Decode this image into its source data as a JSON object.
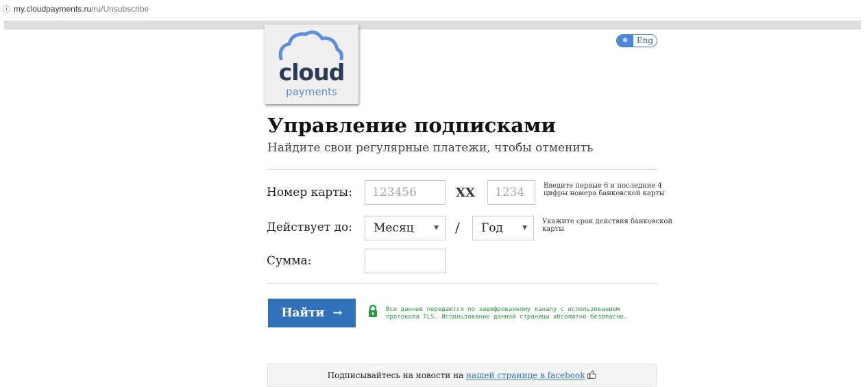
{
  "browser": {
    "url_host": "my.cloudpayments.ru",
    "url_path": "/ru/Unsubscribe"
  },
  "logo": {
    "line1": "cloud",
    "line2": "payments"
  },
  "lang_toggle": {
    "label": "Eng"
  },
  "page": {
    "title": "Управление подписками",
    "subtitle": "Найдите свои регулярные платежи, чтобы отменить"
  },
  "form": {
    "card_label": "Номер карты:",
    "card_first_placeholder": "123456",
    "card_middle": "XX",
    "card_last_placeholder": "1234",
    "card_hint": [
      "Введите первые 6 и последние 4",
      "цифры номера банковской карты"
    ],
    "expiry_label": "Действует до:",
    "month_selected": "Месяц",
    "slash": "/",
    "year_selected": "Год",
    "expiry_hint": [
      "Укажите срок действия банковской",
      "карты"
    ],
    "amount_label": "Сумма:",
    "amount_value": ""
  },
  "actions": {
    "find_label": "Найти",
    "find_arrow": "→"
  },
  "security_note": [
    "Все данные передаются по зашифрованному каналу с использованием",
    "протокола TLS. Использование данной страницы абсолютно безопасно."
  ],
  "footer": {
    "prefix": "Подписывайтесь на новости на ",
    "link_text": "нашей странице в facebook",
    "icon": "thumbs-up-icon"
  },
  "colors": {
    "accent": "#2f72b9",
    "secure_green": "#2e9a45",
    "logo_cloud": "#5b8fd9"
  }
}
